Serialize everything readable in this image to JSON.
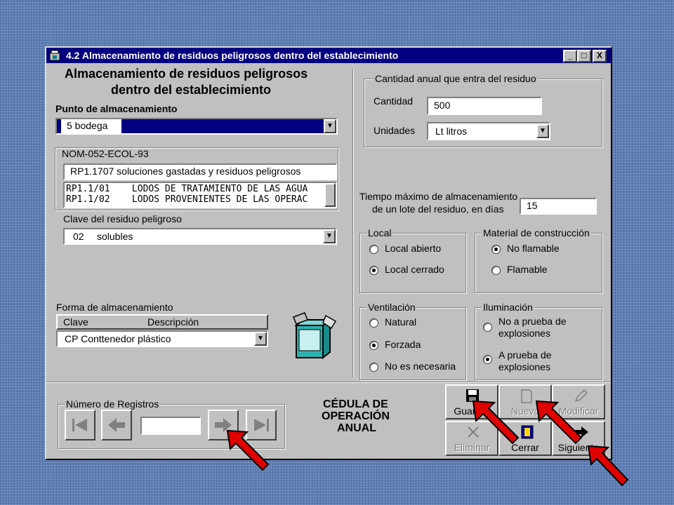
{
  "window": {
    "title": "4.2 Almacenamiento de residuos peligrosos dentro del establecimiento",
    "controls": [
      "_",
      "□",
      "X"
    ]
  },
  "heading": {
    "line1": "Almacenamiento de residuos peligrosos",
    "line2": "dentro del establecimiento"
  },
  "punto": {
    "label": "Punto de almacenamiento",
    "value": "5  bodega"
  },
  "nom": {
    "label": "NOM-052-ECOL-93",
    "selected": "RP1.1707 soluciones gastadas y residuos peligrosos",
    "list": [
      "RP1.1/01    LODOS DE TRATAMIENTO DE LAS AGUA",
      "RP1.1/02    LODOS PROVENIENTES DE LAS OPERAC"
    ],
    "clave_label": "Clave del residuo peligroso",
    "clave_code": "02",
    "clave_desc": "solubles"
  },
  "forma": {
    "label": "Forma de almacenamiento",
    "col_clave": "Clave",
    "col_desc": "Descripción",
    "value": "CP  Conttenedor plástico"
  },
  "cantidad": {
    "group": "Cantidad anual que entra del residuo",
    "cantidad_label": "Cantidad",
    "cantidad_value": "500",
    "unidades_label": "Unidades",
    "unidades_value": "Lt litros"
  },
  "tiempo": {
    "line1": "Tiempo máximo de almacenamiento",
    "line2": "de un lote del residuo, en días",
    "value": "15"
  },
  "local": {
    "group": "Local",
    "options": [
      "Local abierto",
      "Local cerrado"
    ],
    "selected": 1
  },
  "material": {
    "group": "Material de construcción",
    "options": [
      "No flamable",
      "Flamable"
    ],
    "selected": 0
  },
  "ventilacion": {
    "group": "Ventilación",
    "options": [
      "Natural",
      "Forzada",
      "No es necesaria"
    ],
    "selected": 1
  },
  "iluminacion": {
    "group": "Iluminación",
    "options": [
      "No a prueba de explosiones",
      "A prueba de explosiones"
    ],
    "opt1_l1": "No a prueba de",
    "opt1_l2": "explosiones",
    "opt2_l1": "A prueba de",
    "opt2_l2": "explosiones",
    "selected": 1
  },
  "registros": {
    "group": "Número de Registros",
    "value": ""
  },
  "cedula": {
    "line1": "CÉDULA DE",
    "line2": "OPERACIÓN",
    "line3": "ANUAL"
  },
  "toolbar": {
    "guardar": "Guardar",
    "nuevo": "Nuevo",
    "modificar": "Modificar",
    "eliminar": "Eliminar",
    "cerrar": "Cerrar",
    "siguiente": "Siguiente"
  },
  "colors": {
    "titlebar": "#000080",
    "face": "#c0c0c0",
    "arrow": "#e00000",
    "desktop": "#5f7fb5"
  }
}
